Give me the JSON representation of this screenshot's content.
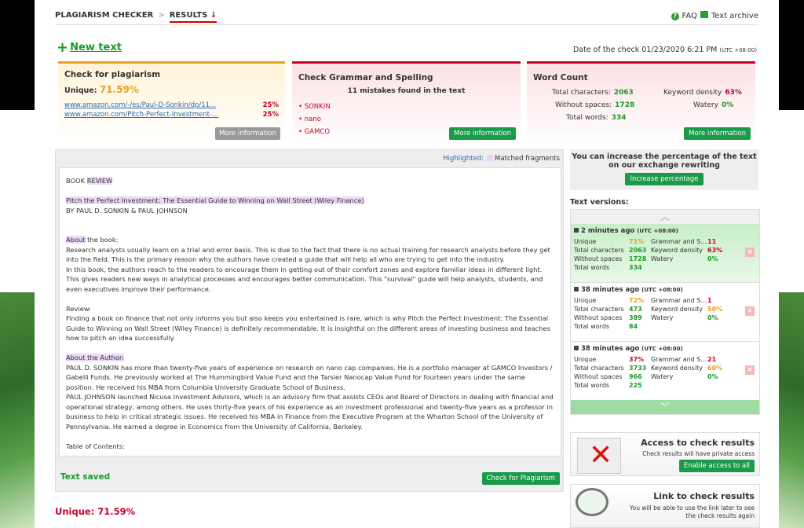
{
  "nav": {
    "crumb1": "PLAGIARISM CHECKER",
    "sep": ">",
    "crumb2": "RESULTS",
    "crumb2_arrow": "↓",
    "faq": "FAQ",
    "archive": "Text archive"
  },
  "newtext": {
    "plus": "+",
    "label": "New text"
  },
  "date": {
    "label": "Date of the check",
    "value": "01/23/2020 6:21 PM",
    "tz": "(UTC +08:00)"
  },
  "plag": {
    "title": "Check for plagiarism",
    "unique_label": "Unique:",
    "unique_value": "71.59%",
    "sources": [
      {
        "url": "www.amazon.com/-/es/Paul-D-Sonkin/dp/11...",
        "pct": "25%"
      },
      {
        "url": "www.amazon.com/Pitch-Perfect-Investment-...",
        "pct": "25%"
      }
    ],
    "more": "More information"
  },
  "grammar": {
    "title": "Check Grammar and Spelling",
    "mistakes": "11 mistakes found in the text",
    "items": [
      "SONKIN",
      "nano",
      "GAMCO"
    ],
    "more": "More information"
  },
  "wordcount": {
    "title": "Word Count",
    "total_chars_label": "Total characters:",
    "total_chars": "2063",
    "without_spaces_label": "Without spaces:",
    "without_spaces": "1728",
    "total_words_label": "Total words:",
    "total_words": "334",
    "kd_label": "Keyword density",
    "kd": "63%",
    "watery_label": "Watery",
    "watery": "0%",
    "more": "More information"
  },
  "editor": {
    "highlighted": "Highlighted:",
    "matched": "Matched fragments",
    "saved": "Text saved",
    "check_btn": "Check for Plagiarism"
  },
  "text": {
    "l1a": "BOOK ",
    "l1b": "REVIEW",
    "l2": "Pitch the Perfect Investment: The Essential Guide to Winning on Wall Street (Wiley Finance)",
    "l3": "BY PAUL D. SONKIN & PAUL JOHNSON",
    "l4a": "About",
    "l4b": " the book:",
    "l5": "Research analysts usually learn on a trial and error basis. This is due to the fact that there is no actual training for research analysts before they get into the field. This is the primary reason why the authors have created a guide that will help all who are trying to get into the industry.",
    "l6": "In this book, the authors reach to the readers to encourage them in getting out of their comfort zones and explore familiar ideas in different light. This gives readers new ways in analytical processes and encourages better communication. This \"survival\" guide will help analysts, students, and even executives improve their performance.",
    "l7": "Review:",
    "l8": "Finding a book on finance that not only informs you but also keeps you entertained is rare, which is why Pitch the Perfect Investment: The Essential Guide to Winning on Wall Street (Wiley Finance) is definitely recommendable. It is insightful on the different areas of investing business and teaches how to pitch an idea successfully.",
    "l9": "About the Author:",
    "l10": "PAUL D. SONKIN has more than twenty-five years of experience on research on nano cap companies. He is a portfolio manager at GAMCO Investors / Gabelli Funds. He previously worked at The Hummingbird Value Fund and the Tarsier Nanocap Value Fund for fourteen years under the same position. He received his MBA from Columbia University Graduate School of Business.",
    "l11": "PAUL JOHNSON launched Nicusa Investment Advisors, which is an advisory firm that assists CEOs and Board of Directors in dealing with financial and operational strategy, among others. He uses thirty-five years of his experience as an investment professional and twenty-five years as a professor in business to help in critical strategic issues. He received his MBA in Finance from the Executive Program at the Wharton School of the University of Pennsylvania. He earned a degree in Economics from the University of California, Berkeley.",
    "l12": "Table of Contents:"
  },
  "bottom": {
    "unique": "Unique: 71.59%"
  },
  "promo": {
    "text": "You can increase the percentage of the text on our exchange rewriting",
    "btn": "Increase percentage"
  },
  "versions": {
    "title": "Text versions:",
    "up": "︿",
    "down": "﹀",
    "x": "×",
    "labels": {
      "unique": "Unique",
      "total_chars": "Total characters",
      "without_spaces": "Without spaces",
      "total_words": "Total words",
      "grammar": "Grammar and S...",
      "kd": "Keyword density",
      "watery": "Watery"
    },
    "items": [
      {
        "time": "2 minutes ago",
        "tz": "(UTC +08:00)",
        "unique": "71%",
        "chars": "2063",
        "nospace": "1728",
        "words": "334",
        "grammar": "11",
        "kd": "63%",
        "watery": "0%"
      },
      {
        "time": "38 minutes ago",
        "tz": "(UTC +08:00)",
        "unique": "72%",
        "chars": "473",
        "nospace": "389",
        "words": "84",
        "grammar": "1",
        "kd": "50%",
        "watery": "0%"
      },
      {
        "time": "38 minutes ago",
        "tz": "(UTC +08:00)",
        "unique": "37%",
        "chars": "3733",
        "nospace": "966",
        "words": "225",
        "grammar": "21",
        "kd": "60%",
        "watery": "0%"
      }
    ]
  },
  "access": {
    "title": "Access to check results",
    "desc": "Check results will have private access",
    "btn": "Enable access to all"
  },
  "link": {
    "title": "Link to check results",
    "desc": "You will be able to use the link later to see the check results again"
  }
}
